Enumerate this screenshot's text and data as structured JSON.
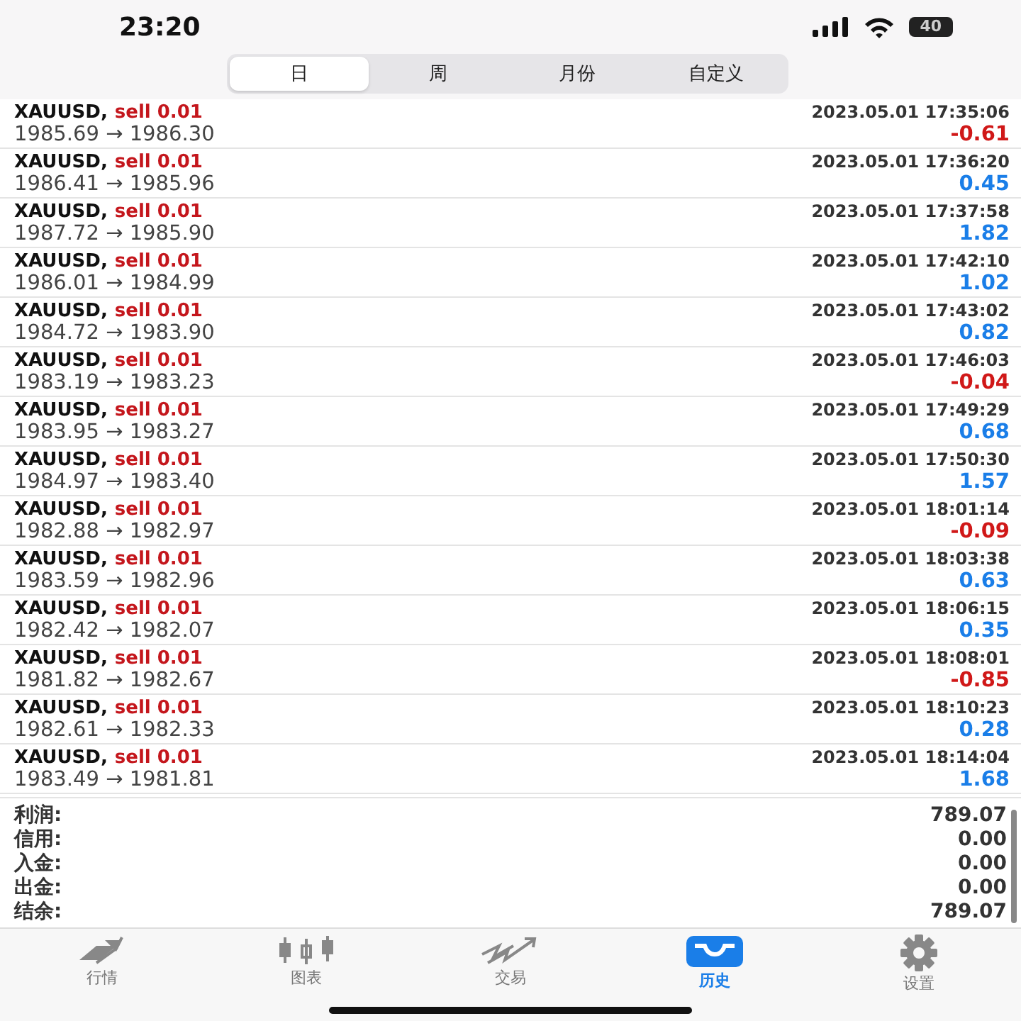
{
  "status_bar": {
    "time": "23:20",
    "battery": "40"
  },
  "tabs": [
    {
      "label": "日",
      "selected": true
    },
    {
      "label": "周",
      "selected": false
    },
    {
      "label": "月份",
      "selected": false
    },
    {
      "label": "自定义",
      "selected": false
    }
  ],
  "trades": [
    {
      "symbol": "XAUUSD,",
      "order": "sell 0.01",
      "time": "2023.05.01 17:35:06",
      "prices": "1985.69 → 1986.30",
      "profit": "-0.61",
      "loss": true
    },
    {
      "symbol": "XAUUSD,",
      "order": "sell 0.01",
      "time": "2023.05.01 17:36:20",
      "prices": "1986.41 → 1985.96",
      "profit": "0.45",
      "loss": false
    },
    {
      "symbol": "XAUUSD,",
      "order": "sell 0.01",
      "time": "2023.05.01 17:37:58",
      "prices": "1987.72 → 1985.90",
      "profit": "1.82",
      "loss": false
    },
    {
      "symbol": "XAUUSD,",
      "order": "sell 0.01",
      "time": "2023.05.01 17:42:10",
      "prices": "1986.01 → 1984.99",
      "profit": "1.02",
      "loss": false
    },
    {
      "symbol": "XAUUSD,",
      "order": "sell 0.01",
      "time": "2023.05.01 17:43:02",
      "prices": "1984.72 → 1983.90",
      "profit": "0.82",
      "loss": false
    },
    {
      "symbol": "XAUUSD,",
      "order": "sell 0.01",
      "time": "2023.05.01 17:46:03",
      "prices": "1983.19 → 1983.23",
      "profit": "-0.04",
      "loss": true
    },
    {
      "symbol": "XAUUSD,",
      "order": "sell 0.01",
      "time": "2023.05.01 17:49:29",
      "prices": "1983.95 → 1983.27",
      "profit": "0.68",
      "loss": false
    },
    {
      "symbol": "XAUUSD,",
      "order": "sell 0.01",
      "time": "2023.05.01 17:50:30",
      "prices": "1984.97 → 1983.40",
      "profit": "1.57",
      "loss": false
    },
    {
      "symbol": "XAUUSD,",
      "order": "sell 0.01",
      "time": "2023.05.01 18:01:14",
      "prices": "1982.88 → 1982.97",
      "profit": "-0.09",
      "loss": true
    },
    {
      "symbol": "XAUUSD,",
      "order": "sell 0.01",
      "time": "2023.05.01 18:03:38",
      "prices": "1983.59 → 1982.96",
      "profit": "0.63",
      "loss": false
    },
    {
      "symbol": "XAUUSD,",
      "order": "sell 0.01",
      "time": "2023.05.01 18:06:15",
      "prices": "1982.42 → 1982.07",
      "profit": "0.35",
      "loss": false
    },
    {
      "symbol": "XAUUSD,",
      "order": "sell 0.01",
      "time": "2023.05.01 18:08:01",
      "prices": "1981.82 → 1982.67",
      "profit": "-0.85",
      "loss": true
    },
    {
      "symbol": "XAUUSD,",
      "order": "sell 0.01",
      "time": "2023.05.01 18:10:23",
      "prices": "1982.61 → 1982.33",
      "profit": "0.28",
      "loss": false
    },
    {
      "symbol": "XAUUSD,",
      "order": "sell 0.01",
      "time": "2023.05.01 18:14:04",
      "prices": "1983.49 → 1981.81",
      "profit": "1.68",
      "loss": false
    }
  ],
  "summary": [
    {
      "label": "利润:",
      "value": "789.07"
    },
    {
      "label": "信用:",
      "value": "0.00"
    },
    {
      "label": "入金:",
      "value": "0.00"
    },
    {
      "label": "出金:",
      "value": "0.00"
    },
    {
      "label": "结余:",
      "value": "789.07"
    }
  ],
  "tab_bar": [
    {
      "kind": "quotes",
      "label": "行情",
      "selected": false
    },
    {
      "kind": "chart",
      "label": "图表",
      "selected": false
    },
    {
      "kind": "trade",
      "label": "交易",
      "selected": false
    },
    {
      "kind": "history",
      "label": "历史",
      "selected": true
    },
    {
      "kind": "settings",
      "label": "设置",
      "selected": false
    }
  ]
}
